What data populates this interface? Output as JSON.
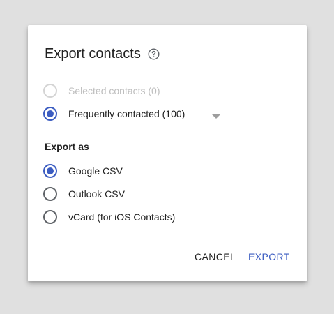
{
  "dialog": {
    "title": "Export contacts",
    "help_icon": "help-circle-icon"
  },
  "contacts_options": [
    {
      "label": "Selected contacts (0)",
      "checked": false,
      "disabled": true
    },
    {
      "label": "Frequently contacted (100)",
      "checked": true,
      "disabled": false
    }
  ],
  "export_as": {
    "heading": "Export as",
    "options": [
      {
        "label": "Google CSV",
        "checked": true
      },
      {
        "label": "Outlook CSV",
        "checked": false
      },
      {
        "label": "vCard (for iOS Contacts)",
        "checked": false
      }
    ]
  },
  "actions": {
    "cancel_label": "CANCEL",
    "export_label": "EXPORT"
  },
  "colors": {
    "accent": "#3b5cc1",
    "background": "#e0e0e0",
    "dialog": "#ffffff"
  }
}
